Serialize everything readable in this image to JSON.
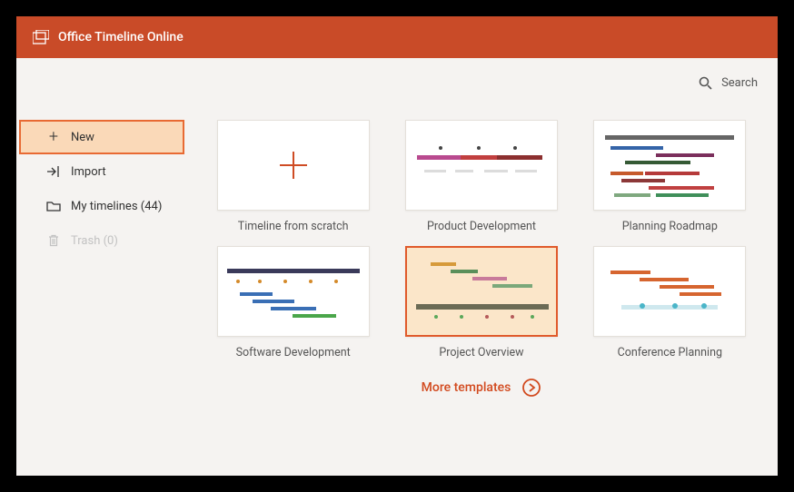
{
  "header": {
    "title": "Office Timeline Online"
  },
  "search": {
    "label": "Search"
  },
  "sidebar": {
    "new_label": "New",
    "import_label": "Import",
    "my_timelines_label": "My timelines (44)",
    "my_timelines_count": 44,
    "trash_label": "Trash (0)",
    "trash_count": 0
  },
  "templates": [
    {
      "label": "Timeline from scratch"
    },
    {
      "label": "Product Development"
    },
    {
      "label": "Planning Roadmap"
    },
    {
      "label": "Software Development"
    },
    {
      "label": "Project Overview"
    },
    {
      "label": "Conference Planning"
    }
  ],
  "more": {
    "label": "More templates"
  },
  "colors": {
    "accent": "#c94b28",
    "highlight_fill": "#fad9b8",
    "highlight_border": "#e86a33"
  }
}
